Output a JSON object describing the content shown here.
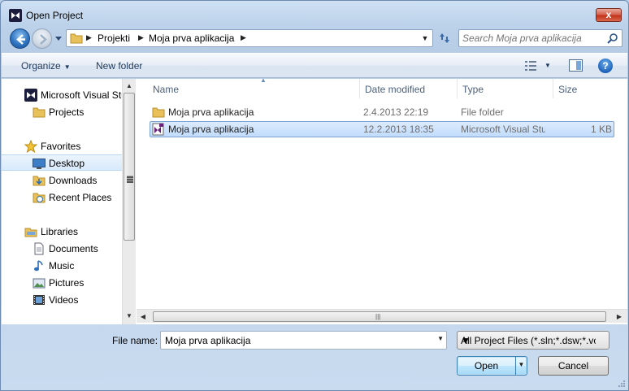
{
  "window": {
    "title": "Open Project",
    "close_label": "x"
  },
  "address": {
    "crumbs": [
      "Projekti",
      "Moja prva aplikacija"
    ]
  },
  "search": {
    "placeholder": "Search Moja prva aplikacija"
  },
  "toolbar": {
    "organize_label": "Organize",
    "new_folder_label": "New folder"
  },
  "navpane": {
    "items": [
      {
        "label": "Microsoft Visual Studio",
        "icon": "visual-studio-icon"
      },
      {
        "label": "Projects",
        "icon": "folder-icon"
      },
      {
        "label": "Favorites",
        "icon": "star-icon"
      },
      {
        "label": "Desktop",
        "icon": "desktop-icon",
        "selected": true
      },
      {
        "label": "Downloads",
        "icon": "downloads-folder-icon"
      },
      {
        "label": "Recent Places",
        "icon": "recent-places-icon"
      },
      {
        "label": "Libraries",
        "icon": "libraries-icon"
      },
      {
        "label": "Documents",
        "icon": "documents-icon"
      },
      {
        "label": "Music",
        "icon": "music-icon"
      },
      {
        "label": "Pictures",
        "icon": "pictures-icon"
      },
      {
        "label": "Videos",
        "icon": "videos-icon"
      }
    ]
  },
  "columns": {
    "name": "Name",
    "date": "Date modified",
    "type": "Type",
    "size": "Size"
  },
  "files": [
    {
      "name": "Moja prva aplikacija",
      "date": "2.4.2013 22:19",
      "type": "File folder",
      "size": "",
      "icon": "folder-icon"
    },
    {
      "name": "Moja prva aplikacija",
      "date": "12.2.2013 18:35",
      "type": "Microsoft Visual Studio Solution",
      "size": "1 KB",
      "icon": "vs-solution-icon",
      "selected": true
    }
  ],
  "bottom": {
    "file_name_label": "File name:",
    "file_name_value": "Moja prva aplikacija",
    "filter_value": "All Project Files (*.sln;*.dsw;*.vc",
    "open_label": "Open",
    "cancel_label": "Cancel"
  },
  "colors": {
    "accent": "#3c7fb1",
    "selection": "#c1dcfc",
    "folder": "#e8c15a"
  }
}
